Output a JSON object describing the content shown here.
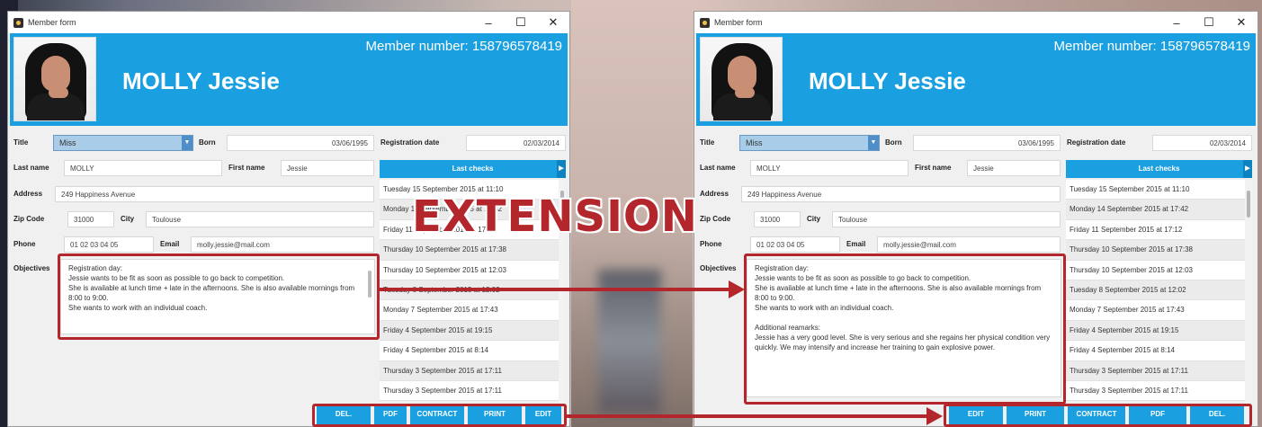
{
  "overlay": {
    "label": "EXTENSION",
    "accent": "#b3262c"
  },
  "colors": {
    "banner": "#1aa0e0"
  },
  "left": {
    "title": "Member form",
    "window_controls": {
      "minimize": "–",
      "maximize": "☐",
      "close": "✕"
    },
    "member_number": "Member number: 158796578419",
    "name": "MOLLY Jessie",
    "labels": {
      "title": "Title",
      "born": "Born",
      "registration_date": "Registration date",
      "last_name": "Last name",
      "first_name": "First name",
      "address": "Address",
      "zip": "Zip Code",
      "city": "City",
      "phone": "Phone",
      "email": "Email",
      "objectives": "Objectives"
    },
    "values": {
      "title": "Miss",
      "born": "03/06/1995",
      "registration_date": "02/03/2014",
      "last_name": "MOLLY",
      "first_name": "Jessie",
      "address": "249 Happiness Avenue",
      "zip": "31000",
      "city": "Toulouse",
      "phone": "01 02 03 04 05",
      "email": "molly.jessie@mail.com"
    },
    "objectives": [
      "Registration day:",
      "Jessie wants to be fit as soon as possible to go back to competition.",
      "She is available at lunch time + late in the afternoons. She is also available mornings from 8:00 to 9:00.",
      "She wants to work with an individual coach."
    ],
    "last_checks_header": "Last checks",
    "last_checks": [
      "Tuesday 15 September 2015 at 11:10",
      "Monday 14 September 2015 at 17:42",
      "Friday 11 September 2015 at 17:12",
      "Thursday 10 September 2015 at 17:38",
      "Thursday 10 September 2015 at 12:03",
      "Tuesday 8 September 2015 at 12:02",
      "Monday 7 September 2015 at 17:43",
      "Friday 4 September 2015 at 19:15",
      "Friday 4 September 2015 at 8:14",
      "Thursday 3 September 2015 at 17:11",
      "Thursday 3 September 2015 at 17:11"
    ],
    "buttons": [
      "DEL.",
      "PDF",
      "CONTRACT",
      "PRINT",
      "EDIT"
    ]
  },
  "right": {
    "title": "Member form",
    "window_controls": {
      "minimize": "–",
      "maximize": "☐",
      "close": "✕"
    },
    "member_number": "Member number: 158796578419",
    "name": "MOLLY Jessie",
    "labels": {
      "title": "Title",
      "born": "Born",
      "registration_date": "Registration date",
      "last_name": "Last name",
      "first_name": "First name",
      "address": "Address",
      "zip": "Zip Code",
      "city": "City",
      "phone": "Phone",
      "email": "Email",
      "objectives": "Objectives"
    },
    "values": {
      "title": "Miss",
      "born": "03/06/1995",
      "registration_date": "02/03/2014",
      "last_name": "MOLLY",
      "first_name": "Jessie",
      "address": "249 Happiness Avenue",
      "zip": "31000",
      "city": "Toulouse",
      "phone": "01 02 03 04 05",
      "email": "molly.jessie@mail.com"
    },
    "objectives": [
      "Registration day:",
      "Jessie wants to be fit as soon as possible to go back to competition.",
      "She is available at lunch time + late in the afternoons. She is also available mornings from 8:00 to 9:00.",
      "She wants to work with an individual coach.",
      "",
      "Additional reamarks:",
      "Jessie has a very good level. She is very serious and she regains her physical condition very quickly. We may intensify and increase her training to gain explosive power."
    ],
    "last_checks_header": "Last checks",
    "last_checks": [
      "Tuesday 15 September 2015 at 11:10",
      "Monday 14 September 2015 at 17:42",
      "Friday 11 September 2015 at 17:12",
      "Thursday 10 September 2015 at 17:38",
      "Thursday 10 September 2015 at 12:03",
      "Tuesday 8 September 2015 at 12:02",
      "Monday 7 September 2015 at 17:43",
      "Friday 4 September 2015 at 19:15",
      "Friday 4 September 2015 at 8:14",
      "Thursday 3 September 2015 at 17:11",
      "Thursday 3 September 2015 at 17:11"
    ],
    "buttons": [
      "EDIT",
      "PRINT",
      "CONTRACT",
      "PDF",
      "DEL."
    ]
  }
}
